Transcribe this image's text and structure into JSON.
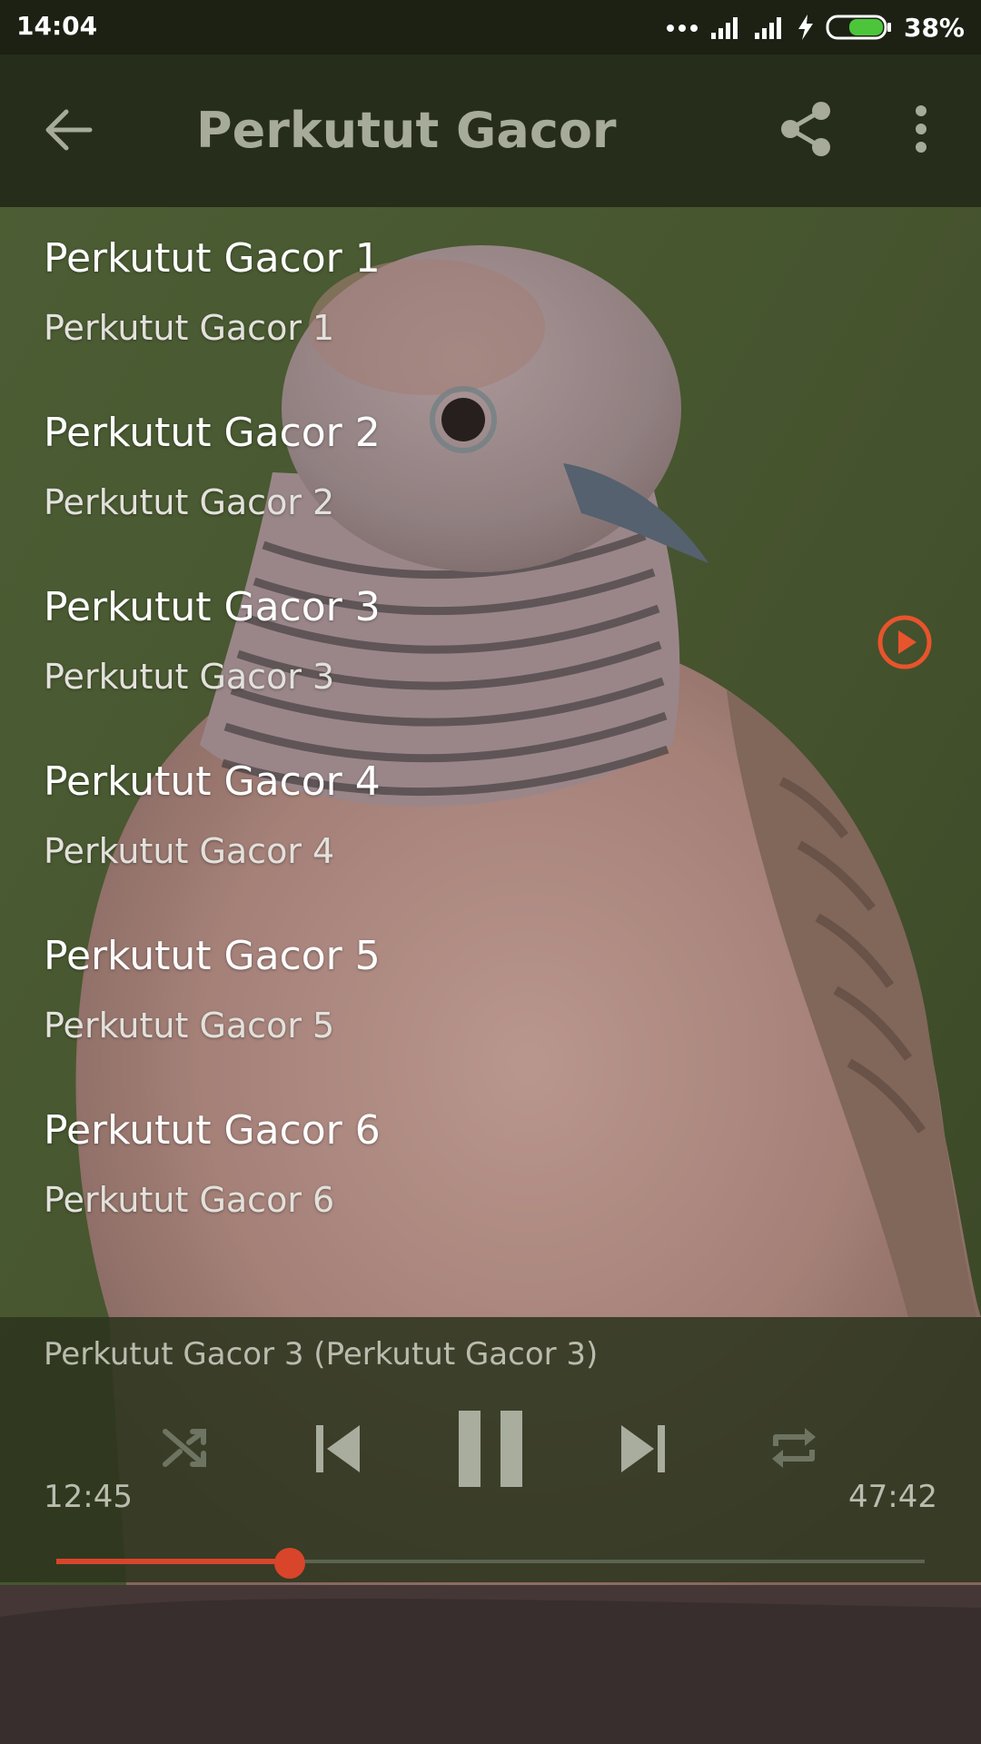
{
  "status_bar": {
    "time": "14:04",
    "battery_percent": "38%",
    "battery_level": 0.38,
    "icons": [
      "more-dots-icon",
      "signal-icon",
      "signal-icon",
      "charging-bolt-icon",
      "battery-icon"
    ]
  },
  "app_bar": {
    "title": "Perkutut Gacor",
    "icons": [
      "back-arrow-icon",
      "share-icon",
      "more-vert-icon"
    ]
  },
  "tracks": [
    {
      "title": "Perkutut Gacor 1",
      "subtitle": "Perkutut Gacor 1",
      "playing": false
    },
    {
      "title": "Perkutut Gacor 2",
      "subtitle": "Perkutut Gacor 2",
      "playing": false
    },
    {
      "title": "Perkutut Gacor 3",
      "subtitle": "Perkutut Gacor 3",
      "playing": true
    },
    {
      "title": "Perkutut Gacor 4",
      "subtitle": "Perkutut Gacor 4",
      "playing": false
    },
    {
      "title": "Perkutut Gacor 5",
      "subtitle": "Perkutut Gacor 5",
      "playing": false
    },
    {
      "title": "Perkutut Gacor 6",
      "subtitle": "Perkutut Gacor 6",
      "playing": false
    }
  ],
  "player": {
    "now_playing": "Perkutut Gacor 3 (Perkutut Gacor 3)",
    "elapsed": "12:45",
    "total": "47:42",
    "progress": 0.269,
    "controls": [
      "shuffle-icon",
      "skip-previous-icon",
      "pause-icon",
      "skip-next-icon",
      "repeat-icon"
    ]
  },
  "colors": {
    "accent": "#d8452a",
    "playing_indicator": "#e8542c",
    "app_bar_bg": "#262d1a",
    "title_text": "#a6ab9a"
  }
}
